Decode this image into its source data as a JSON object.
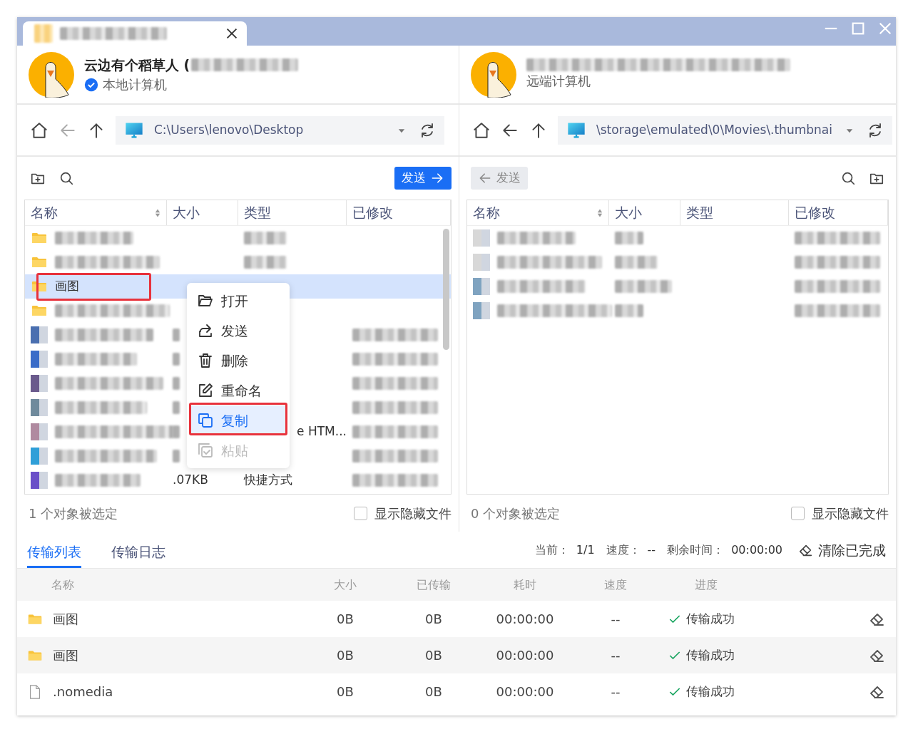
{
  "panes": [
    {
      "kind": "local",
      "user": {
        "name": "云边有个稻草人 (",
        "subtitle": "本地计算机",
        "verified": true
      },
      "nav": {
        "back_disabled": true
      },
      "path": "C:\\Users\\lenovo\\Desktop",
      "send_button": {
        "label": "发送",
        "disabled": false
      },
      "columns": [
        "名称",
        "大小",
        "类型",
        "已修改"
      ],
      "rows": [
        {
          "kind": "folder",
          "selected": false,
          "annotated": false
        },
        {
          "kind": "folder",
          "selected": false,
          "annotated": false
        },
        {
          "kind": "folder",
          "name": "画图",
          "selected": true,
          "annotated": true
        },
        {
          "kind": "folder",
          "selected": false,
          "annotated": false
        },
        {
          "kind": "file",
          "color": "#4a6fb0",
          "selected": false,
          "annotated": false
        },
        {
          "kind": "file",
          "color": "#3a6cc8",
          "selected": false,
          "annotated": false
        },
        {
          "kind": "file",
          "color": "#6a5a8c",
          "selected": false,
          "annotated": false
        },
        {
          "kind": "file",
          "color": "#6f8a9c",
          "selected": false,
          "annotated": false
        },
        {
          "kind": "file",
          "color": "#b08aa0",
          "type": "e HTM...",
          "selected": false,
          "annotated": false
        },
        {
          "kind": "file",
          "color": "#2f9fd8",
          "selected": false,
          "annotated": false
        },
        {
          "kind": "file",
          "color": "#6a4fc8",
          "size": ".07KB",
          "type": "快捷方式",
          "selected": false,
          "annotated": false
        }
      ],
      "status": "1 个对象被选定",
      "show_hidden": {
        "label": "显示隐藏文件",
        "checked": false
      }
    },
    {
      "kind": "remote",
      "user": {
        "subtitle": "远端计算机",
        "verified": false
      },
      "nav": {
        "back_disabled": false
      },
      "path": "\\storage\\emulated\\0\\Movies\\.thumbnai",
      "send_button": {
        "label": "发送",
        "disabled": true
      },
      "columns": [
        "名称",
        "大小",
        "类型",
        "已修改"
      ],
      "rows": [
        {
          "kind": "file",
          "color": "#d8d8d8",
          "selected": false,
          "annotated": false
        },
        {
          "kind": "file",
          "color": "#d8d8d8",
          "selected": false,
          "annotated": false
        },
        {
          "kind": "file",
          "color": "#7fa3c0",
          "selected": false,
          "annotated": false
        },
        {
          "kind": "file",
          "color": "#7fa3c0",
          "selected": false,
          "annotated": false
        }
      ],
      "status": "0 个对象被选定",
      "show_hidden": {
        "label": "显示隐藏文件",
        "checked": false
      }
    }
  ],
  "context_menu": {
    "items": [
      {
        "kind": "open",
        "label": "打开",
        "selected": false,
        "disabled": false,
        "annotated": false
      },
      {
        "kind": "send",
        "label": "发送",
        "selected": false,
        "disabled": false,
        "annotated": false
      },
      {
        "kind": "delete",
        "label": "删除",
        "selected": false,
        "disabled": false,
        "annotated": false
      },
      {
        "kind": "rename",
        "label": "重命名",
        "selected": false,
        "disabled": false,
        "annotated": false
      },
      {
        "kind": "copy",
        "label": "复制",
        "selected": true,
        "disabled": false,
        "annotated": true
      },
      {
        "kind": "paste",
        "label": "粘贴",
        "selected": false,
        "disabled": true,
        "annotated": false
      }
    ]
  },
  "transfer": {
    "tabs": [
      {
        "label": "传输列表",
        "selected": true
      },
      {
        "label": "传输日志",
        "selected": false
      }
    ],
    "stats": [
      {
        "label": "当前：",
        "value": "1/1"
      },
      {
        "label": "速度：",
        "value": "--"
      },
      {
        "label": "剩余时间：",
        "value": "00:00:00"
      }
    ],
    "clear_button": "清除已完成",
    "columns": [
      "名称",
      "大小",
      "已传输",
      "耗时",
      "速度",
      "进度"
    ],
    "rows": [
      {
        "kind": "folder",
        "name": "画图",
        "size": "0B",
        "transferred": "0B",
        "elapsed": "00:00:00",
        "speed": "--",
        "status": "传输成功"
      },
      {
        "kind": "folder",
        "name": "画图",
        "size": "0B",
        "transferred": "0B",
        "elapsed": "00:00:00",
        "speed": "--",
        "status": "传输成功"
      },
      {
        "kind": "file",
        "name": ".nomedia",
        "size": "0B",
        "transferred": "0B",
        "elapsed": "00:00:00",
        "speed": "--",
        "status": "传输成功"
      }
    ]
  }
}
